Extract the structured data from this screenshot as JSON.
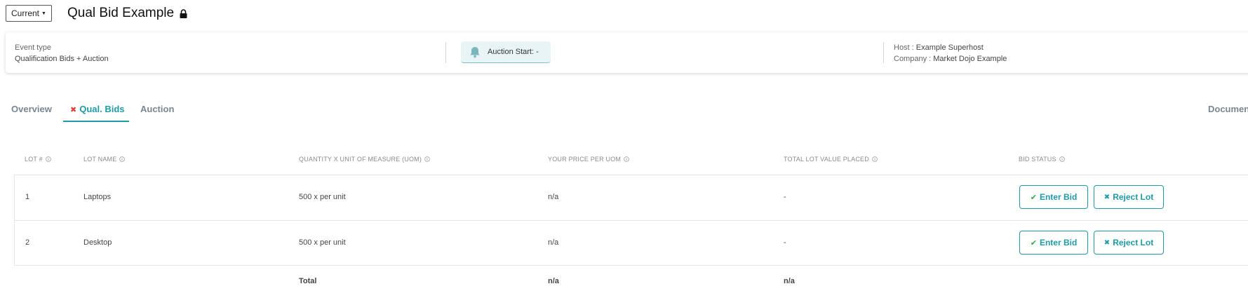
{
  "header": {
    "version_label": "Current",
    "event_title": "Qual Bid Example"
  },
  "info": {
    "event_type_label": "Event type",
    "event_type_value": "Qualification Bids + Auction",
    "auction_start_label": "Auction Start: -",
    "host_label": "Host : ",
    "host_value": "Example Superhost",
    "company_label": "Company : ",
    "company_value": "Market Dojo Example"
  },
  "tabs": [
    {
      "label": "Overview"
    },
    {
      "label": "Qual. Bids"
    },
    {
      "label": "Auction"
    },
    {
      "label": "Documents"
    }
  ],
  "table": {
    "headers": [
      "LOT #",
      "LOT NAME",
      "QUANTITY X UNIT OF MEASURE (UOM)",
      "YOUR PRICE PER UOM",
      "TOTAL LOT VALUE PLACED",
      "BID STATUS"
    ],
    "rows": [
      {
        "lot": "1",
        "name": "Laptops",
        "quantity": "500 x per unit",
        "price": "n/a",
        "total": "-",
        "enter_bid": "Enter Bid",
        "reject_lot": "Reject Lot"
      },
      {
        "lot": "2",
        "name": "Desktop",
        "quantity": "500 x per unit",
        "price": "n/a",
        "total": "-",
        "enter_bid": "Enter Bid",
        "reject_lot": "Reject Lot"
      }
    ],
    "footer": {
      "label": "Total",
      "price": "n/a",
      "total": "n/a"
    }
  },
  "colors": {
    "accent": "#1f9aa6",
    "check": "#2fae4a",
    "error": "#e0403a"
  }
}
